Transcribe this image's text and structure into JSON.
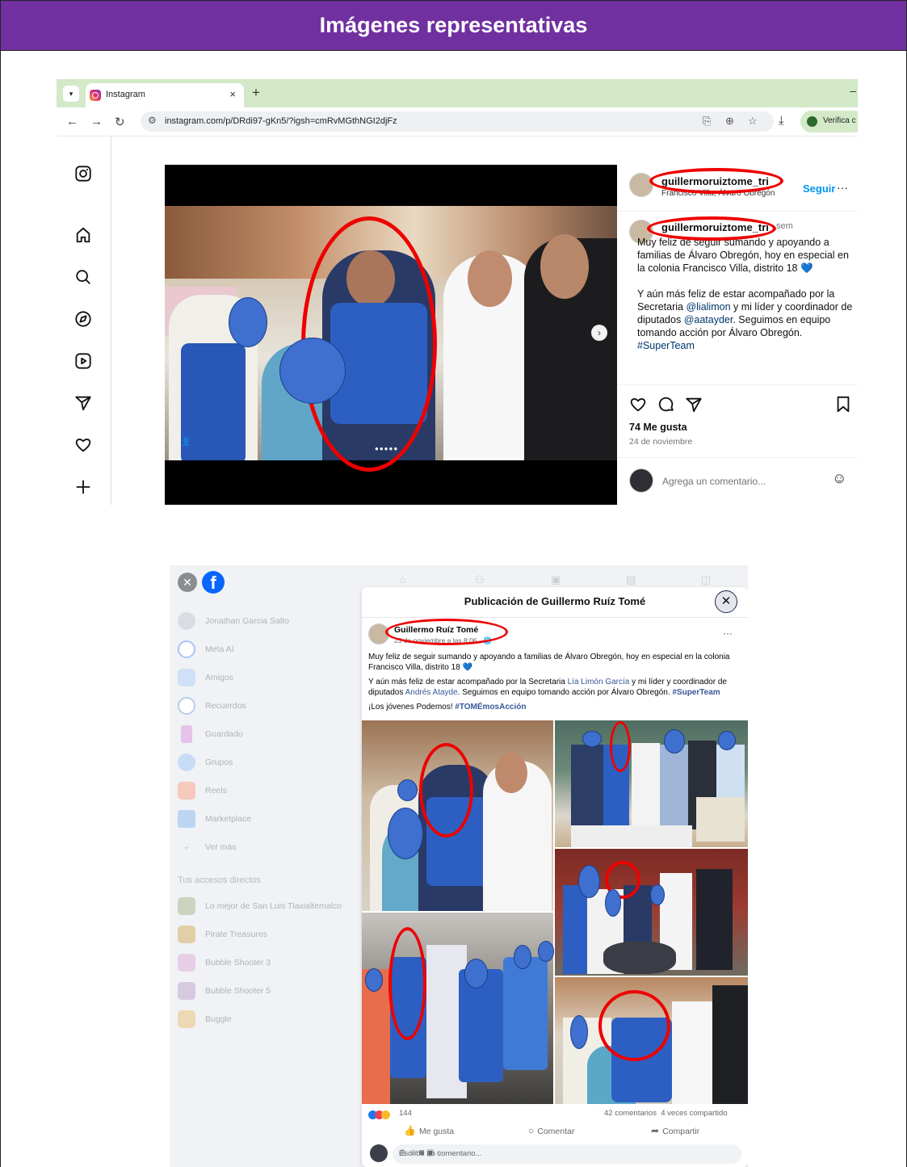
{
  "banner": {
    "title": "Imágenes representativas"
  },
  "instagram": {
    "tab_title": "Instagram",
    "tab_close": "×",
    "new_tab": "+",
    "url": "instagram.com/p/DRdi97-gKn5/?igsh=cmRvMGthNGI2djFz",
    "verify_label": "Verifica c",
    "sidebar_icons": [
      "instagram-logo-icon",
      "home-icon",
      "search-icon",
      "explore-icon",
      "reels-icon",
      "messages-icon",
      "notifications-icon",
      "create-icon"
    ],
    "post": {
      "username": "guillermoruiztome_tri",
      "location": "Francisco Villa, Álvaro Obregón",
      "follow_label": "Seguir",
      "more_label": "···",
      "time_ago": "sem",
      "caption_p1": "Muy feliz de seguir sumando y apoyando a familias de Álvaro Obregón, hoy en especial en la colonia Francisco Villa, distrito 18 💙",
      "caption_p2_a": "Y aún más feliz de estar acompañado por la Secretaria ",
      "mention_1": "@lialimon",
      "caption_p2_b": " y mi líder y coordinador de diputados ",
      "mention_2": "@aatayder",
      "caption_p2_c": ". Seguimos en equipo tomando acción por Álvaro Obregón. ",
      "hashtag": "#SuperTeam",
      "likes": "74 Me gusta",
      "date": "24 de noviembre",
      "comment_placeholder": "Agrega un comentario...",
      "accent_color": "#0095f6"
    }
  },
  "facebook": {
    "sidebar": [
      "Jonathan Garcia Salto",
      "Meta AI",
      "Amigos",
      "Recuerdos",
      "Guardado",
      "Grupos",
      "Reels",
      "Marketplace",
      "Ver más"
    ],
    "shortcuts_title": "Tus accesos directos",
    "shortcuts": [
      "Lo mejor de San Luis Tlaxialtemalco",
      "Pirate Treasures",
      "Bubble Shooter 3",
      "Bubble Shooter 5",
      "Buggle"
    ],
    "modal_title": "Publicación de Guillermo Ruíz Tomé",
    "author": "Guillermo Ruíz Tomé",
    "meta": "23 de noviembre a las 8:06 · 🌐",
    "more_label": "···",
    "text_p1": "Muy feliz de seguir sumando y apoyando a familias de Álvaro Obregón, hoy en especial en la colonia Francisco Villa, distrito 18 💙",
    "text_p2_a": "Y aún más feliz de estar acompañado por la Secretaria ",
    "tag_1": "Lía Limón García",
    "text_p2_b": " y mi líder y coordinador de diputados ",
    "tag_2": "Andrés Atayde",
    "text_p2_c": ". Seguimos en equipo tomando acción por Álvaro Obregón. ",
    "hashtag_1": "#SuperTeam",
    "text_p3": "¡Los jóvenes Podemos! ",
    "hashtag_2": "#TOMÉmosAcción",
    "reactions_count": "144",
    "comments": "42 comentarios",
    "shares": "4 veces compartido",
    "like_label": "Me gusta",
    "comment_label": "Comentar",
    "share_label": "Compartir",
    "comment_placeholder": "Escribe un comentario...",
    "brand_color": "#0866ff"
  },
  "colors": {
    "banner": "#7030a0",
    "highlight": "#e00000",
    "privacy_mask": "#3f6fcf"
  }
}
